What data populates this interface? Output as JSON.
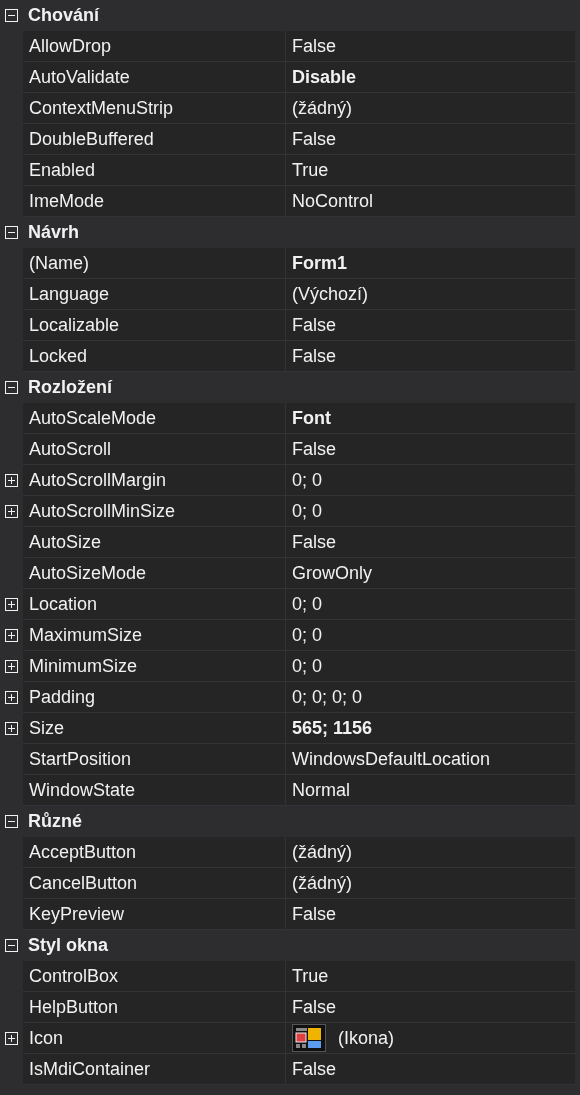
{
  "categories": [
    {
      "name": "Chování",
      "expanded": true,
      "properties": [
        {
          "name": "AllowDrop",
          "value": "False",
          "modified": false
        },
        {
          "name": "AutoValidate",
          "value": "Disable",
          "modified": true
        },
        {
          "name": "ContextMenuStrip",
          "value": "(žádný)",
          "modified": false
        },
        {
          "name": "DoubleBuffered",
          "value": "False",
          "modified": false
        },
        {
          "name": "Enabled",
          "value": "True",
          "modified": false
        },
        {
          "name": "ImeMode",
          "value": "NoControl",
          "modified": false
        }
      ]
    },
    {
      "name": "Návrh",
      "expanded": true,
      "properties": [
        {
          "name": "(Name)",
          "value": "Form1",
          "modified": true
        },
        {
          "name": "Language",
          "value": "(Výchozí)",
          "modified": false
        },
        {
          "name": "Localizable",
          "value": "False",
          "modified": false
        },
        {
          "name": "Locked",
          "value": "False",
          "modified": false
        }
      ]
    },
    {
      "name": "Rozložení",
      "expanded": true,
      "properties": [
        {
          "name": "AutoScaleMode",
          "value": "Font",
          "modified": true
        },
        {
          "name": "AutoScroll",
          "value": "False",
          "modified": false
        },
        {
          "name": "AutoScrollMargin",
          "value": "0; 0",
          "modified": false,
          "expanded": false
        },
        {
          "name": "AutoScrollMinSize",
          "value": "0; 0",
          "modified": false,
          "expanded": false
        },
        {
          "name": "AutoSize",
          "value": "False",
          "modified": false
        },
        {
          "name": "AutoSizeMode",
          "value": "GrowOnly",
          "modified": false
        },
        {
          "name": "Location",
          "value": "0; 0",
          "modified": false,
          "expanded": false
        },
        {
          "name": "MaximumSize",
          "value": "0; 0",
          "modified": false,
          "expanded": false
        },
        {
          "name": "MinimumSize",
          "value": "0; 0",
          "modified": false,
          "expanded": false
        },
        {
          "name": "Padding",
          "value": "0; 0; 0; 0",
          "modified": false,
          "expanded": false
        },
        {
          "name": "Size",
          "value": "565; 1156",
          "modified": true,
          "expanded": false
        },
        {
          "name": "StartPosition",
          "value": "WindowsDefaultLocation",
          "modified": false
        },
        {
          "name": "WindowState",
          "value": "Normal",
          "modified": false
        }
      ]
    },
    {
      "name": "Různé",
      "expanded": true,
      "properties": [
        {
          "name": "AcceptButton",
          "value": "(žádný)",
          "modified": false
        },
        {
          "name": "CancelButton",
          "value": "(žádný)",
          "modified": false
        },
        {
          "name": "KeyPreview",
          "value": "False",
          "modified": false
        }
      ]
    },
    {
      "name": "Styl okna",
      "expanded": true,
      "properties": [
        {
          "name": "ControlBox",
          "value": "True",
          "modified": false
        },
        {
          "name": "HelpButton",
          "value": "False",
          "modified": false
        },
        {
          "name": "Icon",
          "value": "(Ikona)",
          "modified": false,
          "expanded": false,
          "kind": "image"
        },
        {
          "name": "IsMdiContainer",
          "value": "False",
          "modified": false
        }
      ]
    }
  ]
}
